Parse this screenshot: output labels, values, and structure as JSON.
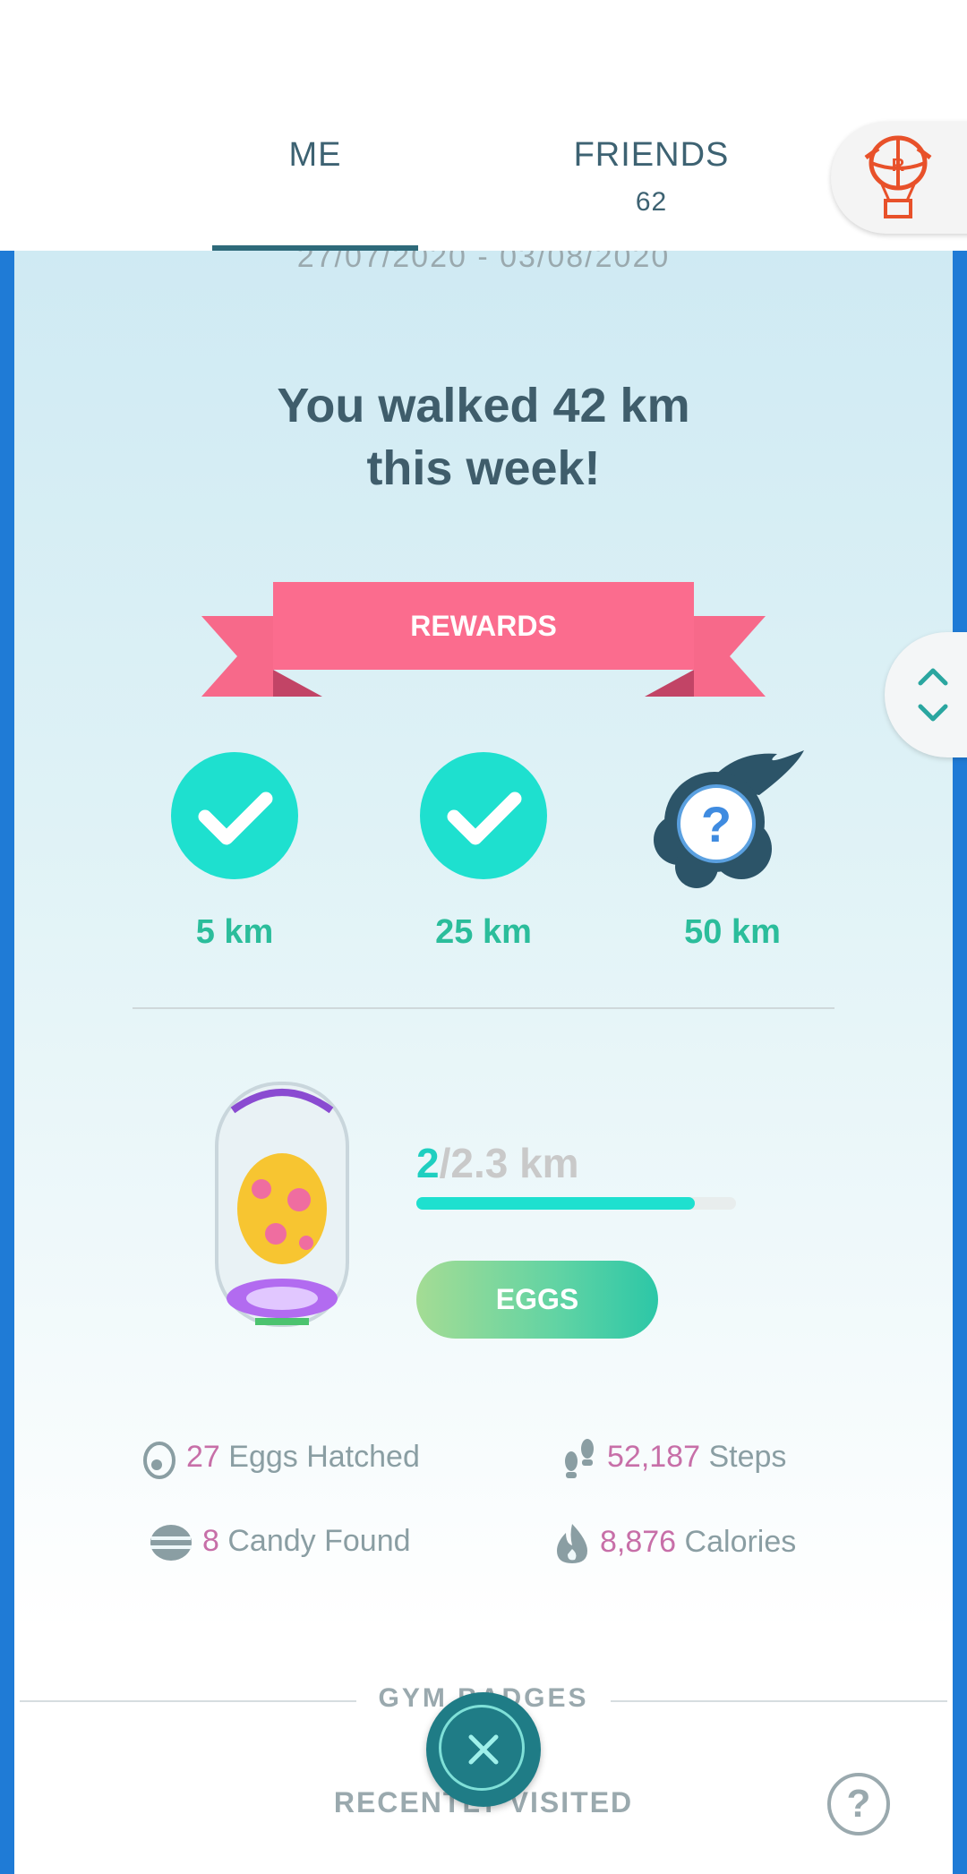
{
  "tabs": {
    "me_label": "ME",
    "friends_label": "FRIENDS",
    "friends_count": "62"
  },
  "journal": {
    "date_range": "27/07/2020 - 03/08/2020",
    "headline_line1": "You walked 42 km",
    "headline_line2": "this week!"
  },
  "rewards": {
    "banner_label": "REWARDS",
    "tiers": [
      {
        "label": "5 km",
        "state": "completed"
      },
      {
        "label": "25 km",
        "state": "completed"
      },
      {
        "label": "50 km",
        "state": "locked"
      }
    ]
  },
  "incubator": {
    "progress_current": "2",
    "progress_total": "/2.3 km",
    "progress_fraction": 0.87,
    "eggs_button": "EGGS"
  },
  "stats": {
    "eggs_hatched_num": "27",
    "eggs_hatched_label": "Eggs Hatched",
    "steps_num": "52,187",
    "steps_label": "Steps",
    "candy_num": "8",
    "candy_label": "Candy Found",
    "calories_num": "8,876",
    "calories_label": "Calories"
  },
  "sections": {
    "gym_badges": "GYM BADGES",
    "recently_visited": "RECENTLY VISITED"
  },
  "icons": {
    "balloon": "team-rocket-balloon-icon",
    "scroll": "chevron-up-down-icon",
    "close": "close-icon",
    "help": "question-icon"
  },
  "colors": {
    "accent_teal": "#1ee0cf",
    "ribbon_pink": "#f7698a",
    "stat_pink": "#c76fa8",
    "border_blue": "#1f7bd6"
  }
}
